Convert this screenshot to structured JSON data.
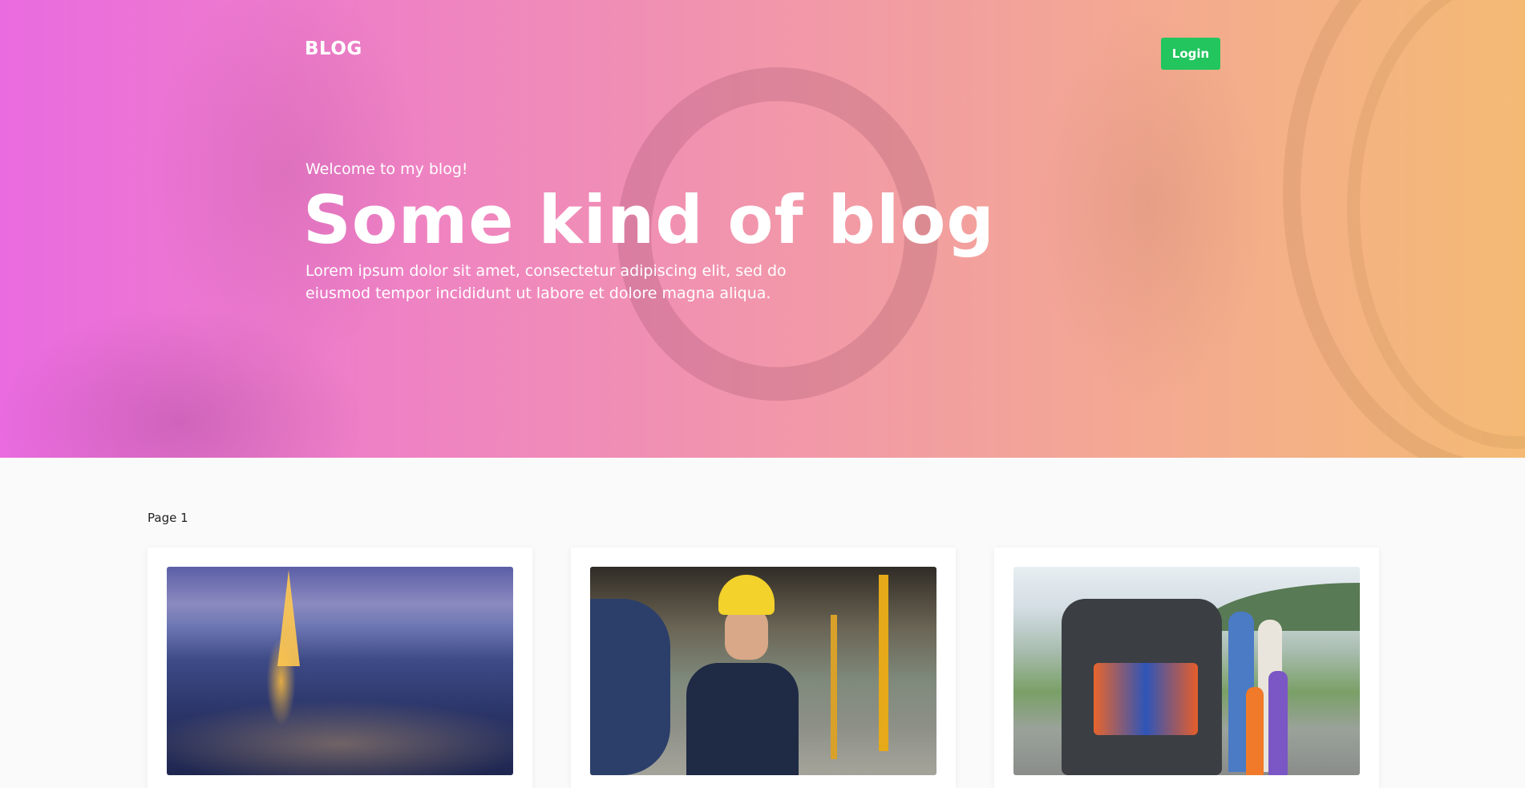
{
  "header": {
    "brand": "BLOG",
    "login_label": "Login",
    "login_color": "#22c55e"
  },
  "hero": {
    "eyebrow": "Welcome to my blog!",
    "title": "Some kind of blog",
    "subtitle_line1": "Lorem ipsum dolor sit amet, consectetur adipiscing elit, sed do",
    "subtitle_line2": "eiusmod tempor incididunt ut labore et dolore magna aliqua.",
    "gradient_start": "#ea6be0",
    "gradient_end": "#f4ba74"
  },
  "content": {
    "page_label": "Page 1",
    "posts": [
      {
        "image": "paris-eiffel-tower-night-photo"
      },
      {
        "image": "industrial-worker-tablet-photo"
      },
      {
        "image": "family-car-road-trip-photo"
      }
    ]
  }
}
